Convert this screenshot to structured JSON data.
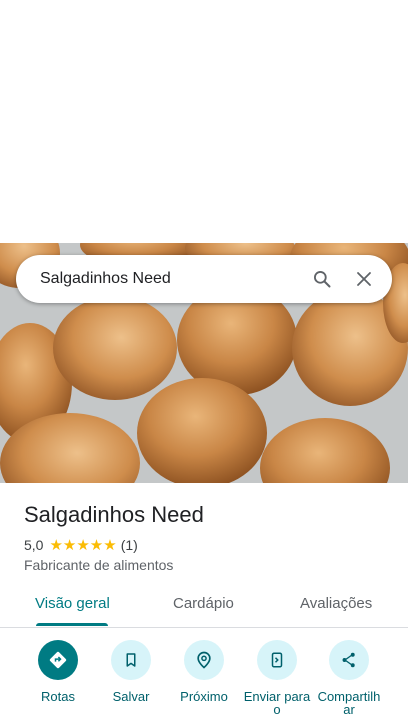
{
  "search": {
    "query": "Salgadinhos Need"
  },
  "place": {
    "name": "Salgadinhos Need",
    "rating": "5,0",
    "stars": "★★★★★",
    "review_count": "(1)",
    "category": "Fabricante de alimentos"
  },
  "tabs": [
    {
      "label": "Visão geral",
      "active": true
    },
    {
      "label": "Cardápio",
      "active": false
    },
    {
      "label": "Avaliações",
      "active": false
    }
  ],
  "actions": [
    {
      "label": "Rotas",
      "icon": "directions-icon"
    },
    {
      "label": "Salvar",
      "icon": "bookmark-icon"
    },
    {
      "label": "Próximo",
      "icon": "nearby-icon"
    },
    {
      "label": "Enviar para o",
      "icon": "send-to-phone-icon"
    },
    {
      "label": "Compartilhar",
      "icon": "share-icon"
    }
  ],
  "colors": {
    "accent": "#007b83",
    "action_bg": "#d7f4f9",
    "star": "#fbbc04"
  }
}
